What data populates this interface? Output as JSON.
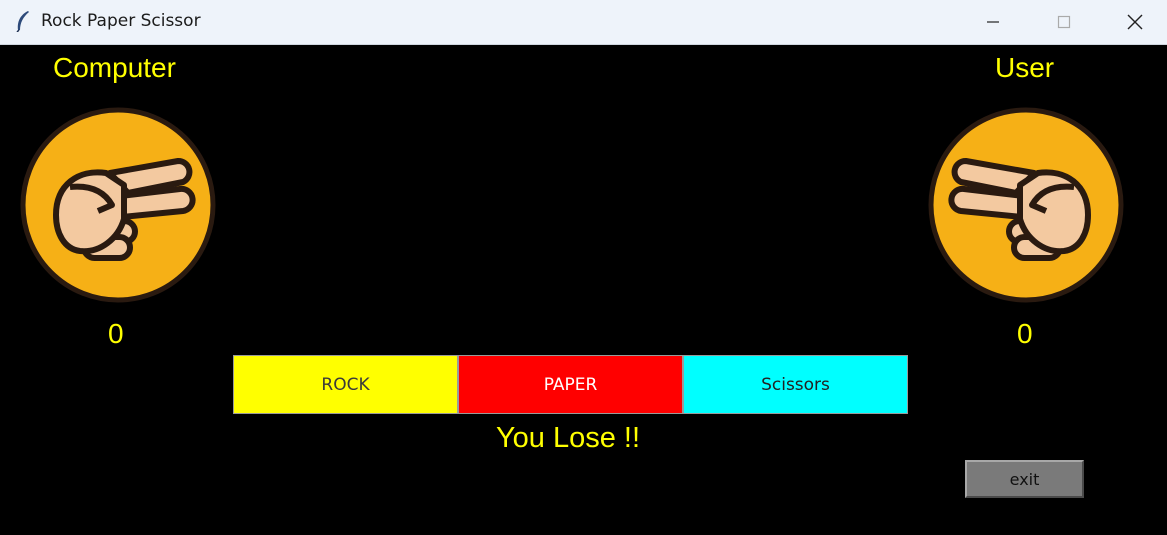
{
  "window": {
    "title": "Rock Paper Scissor",
    "icon": "feather-icon"
  },
  "computer": {
    "label": "Computer",
    "score": "0",
    "hand_icon": "scissors-hand-icon"
  },
  "user": {
    "label": "User",
    "score": "0",
    "hand_icon": "scissors-hand-icon"
  },
  "buttons": {
    "rock": {
      "label": "ROCK",
      "color": "#ffff00"
    },
    "paper": {
      "label": "PAPER",
      "color": "#ff0000"
    },
    "scissors": {
      "label": "Scissors",
      "color": "#00ffff"
    }
  },
  "result": "You Lose !!",
  "exit_label": "exit",
  "colors": {
    "background": "#000000",
    "text": "#ffff00",
    "hand_circle": "#f6b016"
  }
}
